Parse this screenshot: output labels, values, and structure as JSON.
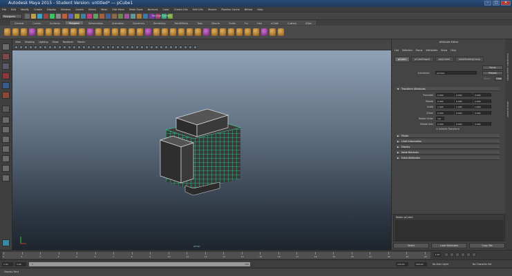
{
  "window": {
    "title": "Autodesk Maya 2015 - Student Version: untitled*    ---    pCube1"
  },
  "menubar": [
    "File",
    "Edit",
    "Modify",
    "Create",
    "Display",
    "Window",
    "Assets",
    "Select",
    "Mesh",
    "Edit Mesh",
    "Mesh Tools",
    "Normals",
    "Color",
    "Create UVs",
    "Edit UVs",
    "Muscle",
    "Pipeline Cache",
    "Bifrost",
    "Help"
  ],
  "status": {
    "menu_set": "Polygons",
    "no_live": "No Live Surface"
  },
  "shelf_tabs": [
    {
      "label": "General",
      "active": false
    },
    {
      "label": "Curves",
      "active": false
    },
    {
      "label": "Surfaces",
      "active": false
    },
    {
      "label": "Polygons",
      "active": true
    },
    {
      "label": "Deformation",
      "active": false
    },
    {
      "label": "Animation",
      "active": false
    },
    {
      "label": "Dynamics",
      "active": false
    },
    {
      "label": "Rendering",
      "active": false
    },
    {
      "label": "PaintEffects",
      "active": false
    },
    {
      "label": "Toon",
      "active": false
    },
    {
      "label": "Muscle",
      "active": false
    },
    {
      "label": "Fluids",
      "active": false
    },
    {
      "label": "Fur",
      "active": false
    },
    {
      "label": "Hair",
      "active": false
    },
    {
      "label": "nCloth",
      "active": false
    },
    {
      "label": "Custom",
      "active": false
    },
    {
      "label": "XGen",
      "active": false
    }
  ],
  "viewport_menu": [
    "View",
    "Shading",
    "Lighting",
    "Show",
    "Renderer",
    "Panels"
  ],
  "viewport": {
    "camera_label": "persp"
  },
  "attribute_editor": {
    "title": "Attribute Editor",
    "menu": [
      "List",
      "Selected",
      "Focus",
      "Attributes",
      "Show",
      "Help"
    ],
    "tabs": [
      {
        "label": "pCube1",
        "active": true
      },
      {
        "label": "pCubeShape1",
        "active": false
      },
      {
        "label": "polyCube1",
        "active": false
      },
      {
        "label": "initialShadingGroup",
        "active": false
      }
    ],
    "buttons": {
      "focus": "Focus",
      "presets": "Presets",
      "show": "Show",
      "hide": "Hide"
    },
    "transform_label": "transform:",
    "transform_value": "pCube1",
    "transform_section": "Transform Attributes",
    "attrs": [
      {
        "label": "Translate",
        "v": [
          "0.000",
          "0.000",
          "0.000"
        ]
      },
      {
        "label": "Rotate",
        "v": [
          "0.000",
          "0.000",
          "0.000"
        ]
      },
      {
        "label": "Scale",
        "v": [
          "1.000",
          "1.000",
          "1.000"
        ]
      },
      {
        "label": "Shear",
        "v": [
          "0.000",
          "0.000",
          "0.000"
        ]
      }
    ],
    "rotate_order_label": "Rotate Order",
    "rotate_order_value": "xyz",
    "rotate_axis_label": "Rotate Axis",
    "rotate_axis": [
      "0.000",
      "0.000",
      "0.000"
    ],
    "inherits_transform": "Inherits Transform",
    "collapsed_sections": [
      "Pivots",
      "Limit Information",
      "Display",
      "Node Behavior",
      "Extra Attributes"
    ],
    "notes_label": "Notes: pCube1",
    "bottom_buttons": [
      "Select",
      "Load Attributes",
      "Copy Tab"
    ]
  },
  "right_tabs": [
    "Channel Box / Layer Editor",
    "Attribute Editor"
  ],
  "timeline": {
    "ticks": [
      "1",
      "2",
      "3",
      "4",
      "5",
      "6",
      "7",
      "8",
      "9",
      "10",
      "11",
      "12",
      "13",
      "14",
      "15",
      "16",
      "17",
      "18",
      "19",
      "20",
      "21",
      "22",
      "23",
      "24"
    ],
    "current_frame": "1.00"
  },
  "range": {
    "start": "1.00",
    "start2": "1.00",
    "bar_start": "1",
    "bar_end": "120",
    "end": "120.00",
    "end2": "200.00",
    "anim_layer": "No Anim Layer",
    "char_set": "No Character Set"
  },
  "helpline": "Display Rect",
  "colors": {
    "wireframe": "#39d49a",
    "viewport_top": "#8fa1b6",
    "viewport_bottom": "#1e252d"
  }
}
